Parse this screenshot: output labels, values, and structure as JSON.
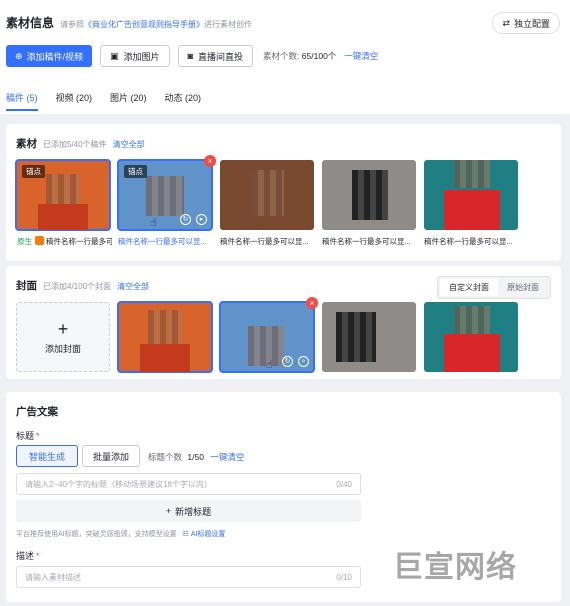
{
  "header": {
    "title": "素材信息",
    "hint_prefix": "请参照",
    "hint_link": "《商业化广告创意观则指导手册》",
    "hint_suffix": "进行素材创作",
    "indep_config": "独立配置"
  },
  "toolbar": {
    "add_video": "添加稿件/视频",
    "add_image": "添加图片",
    "live_direct": "直播间直投",
    "count_label": "素材个数:",
    "count_value": "65/100个",
    "clear_all": "一键清空"
  },
  "tabs": [
    "稿件 (5)",
    "视频 (20)",
    "图片 (20)",
    "动态 (20)"
  ],
  "material": {
    "title": "素材",
    "sub": "已添加5/40个稿件",
    "clear": "清空全部",
    "anchor": "锚点",
    "orig_badge": "原生",
    "items": [
      {
        "caption": "稿件名称一行最多可以显示"
      },
      {
        "caption": "稿件名称一行最多可以显..."
      },
      {
        "caption": "稿件名称一行最多可以显..."
      },
      {
        "caption": "稿件名称一行最多可以显..."
      },
      {
        "caption": "稿件名称一行最多可以显..."
      }
    ]
  },
  "cover": {
    "title": "封面",
    "sub": "已添加4/100个封面",
    "clear": "清空全部",
    "seg_custom": "自定义封面",
    "seg_original": "原始封面",
    "add_cover": "添加封面"
  },
  "adcopy": {
    "title": "广告文案",
    "headline_label": "标题",
    "smart_gen": "智能生成",
    "batch_add": "批量添加",
    "headline_count_label": "标题个数",
    "headline_count": "1/50",
    "clear_all": "一键清空",
    "headline_placeholder": "请输入2~40个字的标题（移动场景建议18个字以内）",
    "headline_counter": "0/40",
    "add_headline": "新增标题",
    "tip": "平台推荐使用AI标题，突破灵感瓶颈，支持模型设置",
    "ai_setting": "AI标题设置",
    "desc_label": "描述",
    "desc_placeholder": "请输入素材描述",
    "desc_counter": "0/10"
  },
  "watermark": "巨宣网络",
  "colors": {
    "accent": "#3370ff",
    "danger": "#f54a45",
    "success": "#1aa260"
  }
}
